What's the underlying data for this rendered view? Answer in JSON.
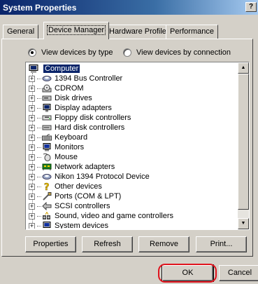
{
  "window": {
    "title": "System Properties",
    "help_label": "?"
  },
  "tabs": [
    {
      "label": "General",
      "active": false
    },
    {
      "label": "Device Manager",
      "active": true
    },
    {
      "label": "Hardware Profiles",
      "active": false
    },
    {
      "label": "Performance",
      "active": false
    }
  ],
  "view_options": {
    "by_type": {
      "label": "View devices by type",
      "selected": true
    },
    "by_connection": {
      "label": "View devices by connection",
      "selected": false
    }
  },
  "tree": {
    "root": {
      "label": "Computer",
      "icon": "computer-icon",
      "selected": true
    },
    "items": [
      {
        "label": "1394 Bus Controller",
        "icon": "bus-controller-icon"
      },
      {
        "label": "CDROM",
        "icon": "cdrom-icon"
      },
      {
        "label": "Disk drives",
        "icon": "disk-drive-icon"
      },
      {
        "label": "Display adapters",
        "icon": "display-adapter-icon"
      },
      {
        "label": "Floppy disk controllers",
        "icon": "floppy-controller-icon"
      },
      {
        "label": "Hard disk controllers",
        "icon": "hard-disk-controller-icon"
      },
      {
        "label": "Keyboard",
        "icon": "keyboard-icon"
      },
      {
        "label": "Monitors",
        "icon": "monitor-icon"
      },
      {
        "label": "Mouse",
        "icon": "mouse-icon"
      },
      {
        "label": "Network adapters",
        "icon": "network-adapter-icon"
      },
      {
        "label": "Nikon 1394 Protocol Device",
        "icon": "protocol-device-icon"
      },
      {
        "label": "Other devices",
        "icon": "question-mark-icon"
      },
      {
        "label": "Ports (COM & LPT)",
        "icon": "port-icon"
      },
      {
        "label": "SCSI controllers",
        "icon": "scsi-controller-icon"
      },
      {
        "label": "Sound, video and game controllers",
        "icon": "sound-controller-icon"
      },
      {
        "label": "System devices",
        "icon": "system-device-icon"
      }
    ]
  },
  "buttons": {
    "properties": "Properties",
    "refresh": "Refresh",
    "remove": "Remove",
    "print": "Print...",
    "ok": "OK",
    "cancel": "Cancel"
  },
  "colors": {
    "selection": "#0a246a",
    "highlight_ring": "#e0141e",
    "face": "#d4d0c8"
  }
}
